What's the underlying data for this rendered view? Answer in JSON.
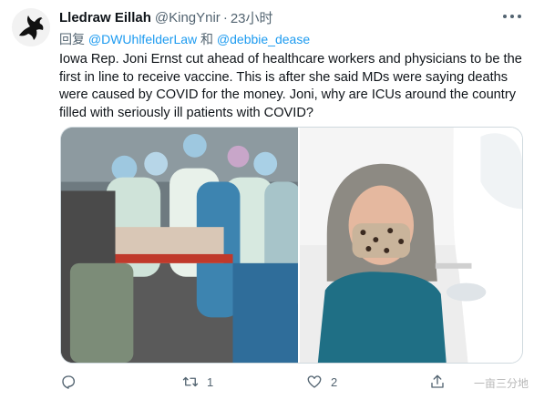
{
  "author": {
    "display_name": "Lledraw Eillah",
    "handle": "@KingYnir",
    "separator": "·",
    "time": "23小时"
  },
  "reply": {
    "prefix": "回复",
    "mention_1": "@DWUhlfelderLaw",
    "conjunction": "和",
    "mention_2": "@debbie_dease"
  },
  "tweet": {
    "text": "Iowa Rep. Joni Ernst cut ahead of healthcare workers and physicians to be the first in line to receive vaccine.  This is after she said MDs were saying deaths were caused by COVID for the money.  Joni, why are ICUs around the country filled with seriously ill patients with COVID?"
  },
  "actions": {
    "reply_count": "",
    "retweet_count": "1",
    "like_count": "2"
  },
  "watermark": {
    "text": "一亩三分地"
  },
  "icons": {
    "avatar": "crow-icon",
    "reply": "comment-icon",
    "retweet": "retweet-icon",
    "like": "heart-icon",
    "share": "share-icon",
    "more": "more-icon"
  },
  "colors": {
    "link": "#1d9bf0",
    "muted": "#536471",
    "text": "#0f1419"
  }
}
